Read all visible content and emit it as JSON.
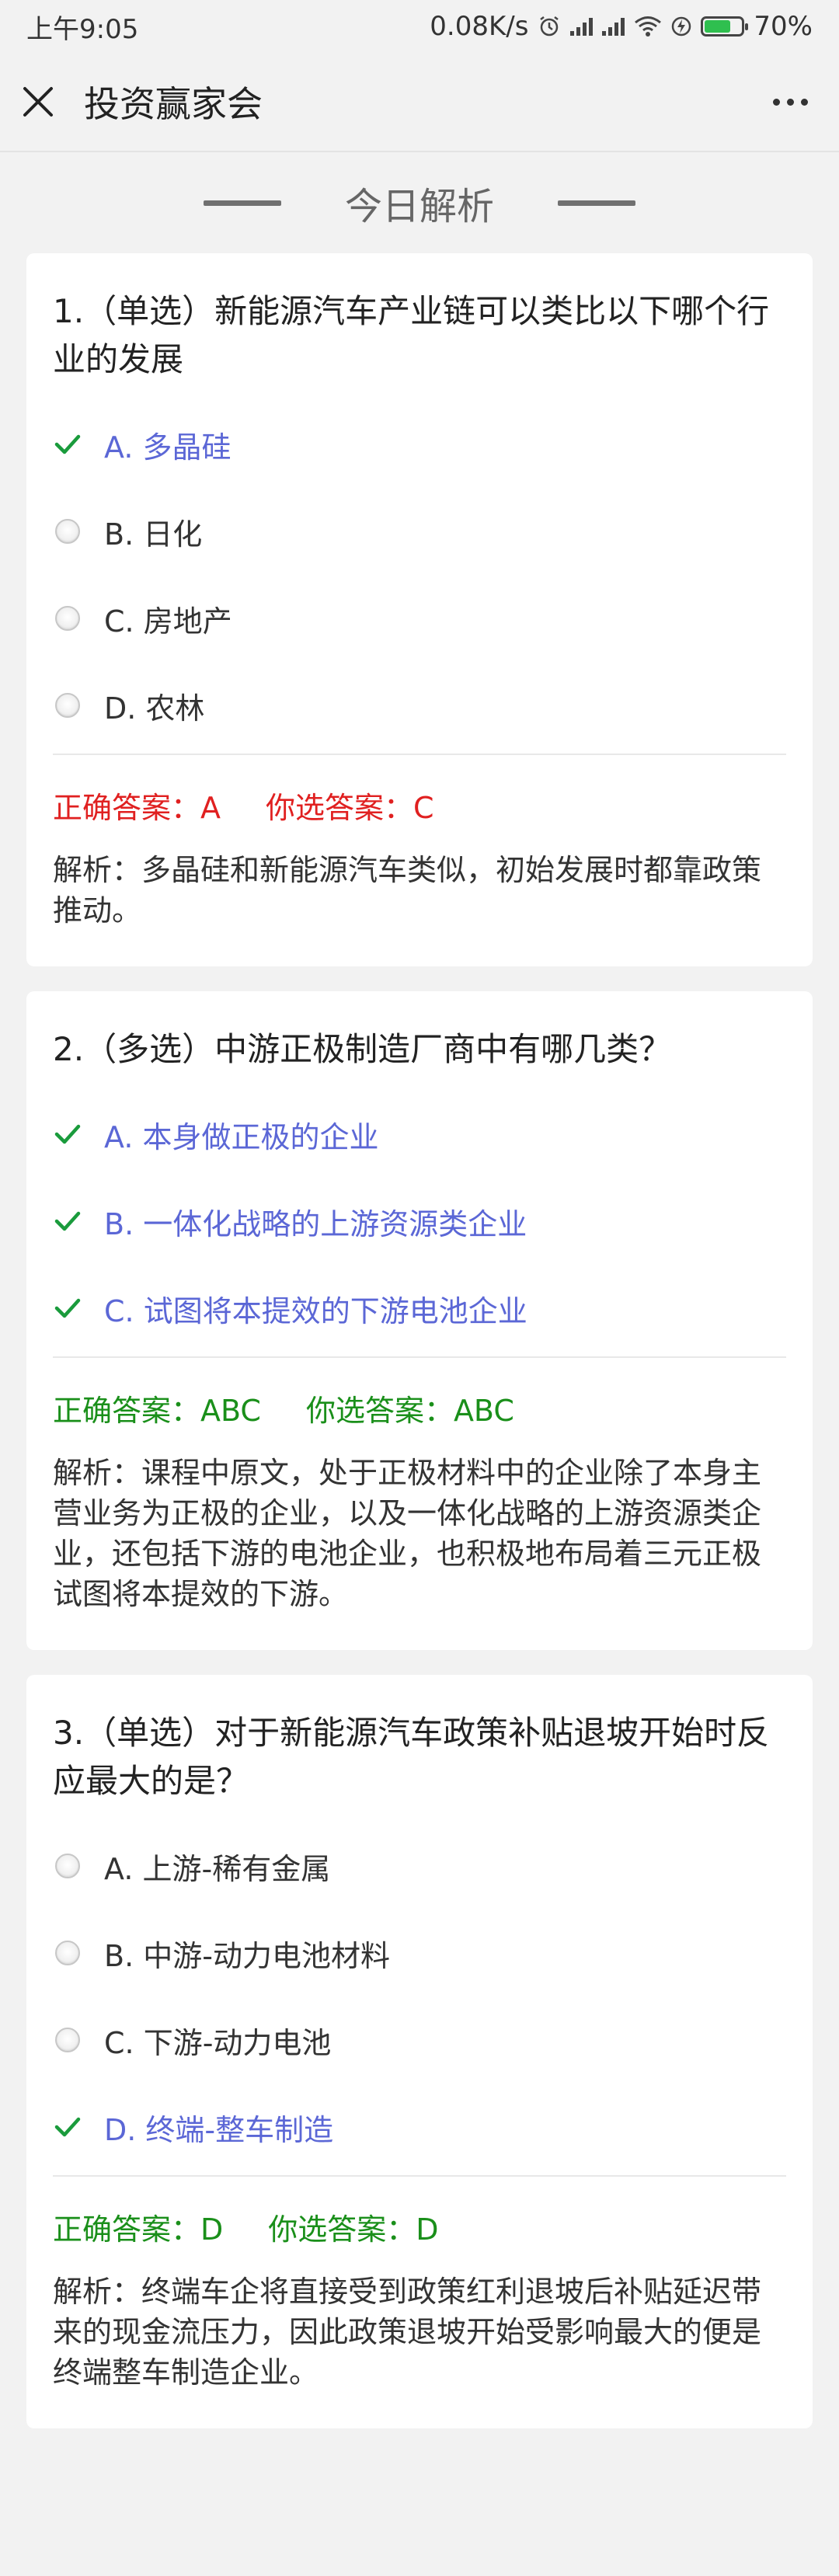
{
  "status_bar": {
    "time": "上午9:05",
    "net_speed": "0.08K/s",
    "battery_pct": "70%",
    "battery_level": 0.7,
    "icons": [
      "alarm-icon",
      "signal-icon",
      "signal-icon",
      "wifi-icon",
      "charging-icon",
      "battery-icon"
    ]
  },
  "nav": {
    "title": "投资赢家会",
    "close_icon": "close-icon",
    "more_icon": "more-icon"
  },
  "section_title": "今日解析",
  "colors": {
    "correct_option": "#5b67d6",
    "check": "#1a9b3c",
    "wrong": "#e02020",
    "right": "#1a8f1a"
  },
  "questions": [
    {
      "title": "1.（单选）新能源汽车产业链可以类比以下哪个行业的发展",
      "options": [
        {
          "label": "A. 多晶硅",
          "correct": true
        },
        {
          "label": "B. 日化",
          "correct": false
        },
        {
          "label": "C. 房地产",
          "correct": false
        },
        {
          "label": "D. 农林",
          "correct": false
        }
      ],
      "correct_answer": "正确答案：A",
      "your_answer": "你选答案：C",
      "is_right": false,
      "analysis": "解析：多晶硅和新能源汽车类似，初始发展时都靠政策推动。"
    },
    {
      "title": "2.（多选）中游正极制造厂商中有哪几类？",
      "options": [
        {
          "label": "A. 本身做正极的企业",
          "correct": true
        },
        {
          "label": "B. 一体化战略的上游资源类企业",
          "correct": true
        },
        {
          "label": "C. 试图将本提效的下游电池企业",
          "correct": true
        }
      ],
      "correct_answer": "正确答案：ABC",
      "your_answer": "你选答案：ABC",
      "is_right": true,
      "analysis": "解析：课程中原文，处于正极材料中的企业除了本身主营业务为正极的企业，以及一体化战略的上游资源类企业，还包括下游的电池企业，也积极地布局着三元正极试图将本提效的下游。"
    },
    {
      "title": "3.（单选）对于新能源汽车政策补贴退坡开始时反应最大的是？",
      "options": [
        {
          "label": "A. 上游-稀有金属",
          "correct": false
        },
        {
          "label": "B. 中游-动力电池材料",
          "correct": false
        },
        {
          "label": "C. 下游-动力电池",
          "correct": false
        },
        {
          "label": "D. 终端-整车制造",
          "correct": true
        }
      ],
      "correct_answer": "正确答案：D",
      "your_answer": "你选答案：D",
      "is_right": true,
      "analysis": "解析：终端车企将直接受到政策红利退坡后补贴延迟带来的现金流压力，因此政策退坡开始受影响最大的便是终端整车制造企业。"
    }
  ]
}
